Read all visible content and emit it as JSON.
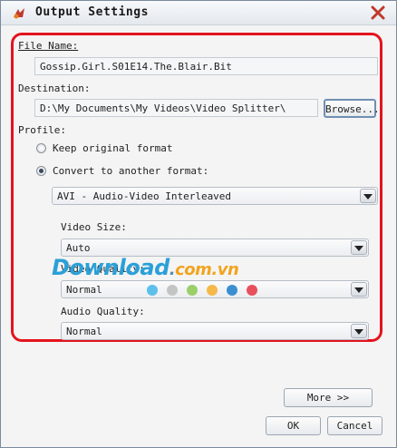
{
  "window": {
    "title": "Output Settings"
  },
  "file_name": {
    "label": "File Name:",
    "value": "Gossip.Girl.S01E14.The.Blair.Bit"
  },
  "destination": {
    "label": "Destination:",
    "value": "D:\\My Documents\\My Videos\\Video Splitter\\",
    "browse_label": "Browse..."
  },
  "profile": {
    "label": "Profile:",
    "keep_original": {
      "label": "Keep original format",
      "selected": false
    },
    "convert": {
      "label": "Convert to another format:",
      "selected": true
    },
    "format": {
      "value": "AVI - Audio-Video Interleaved"
    }
  },
  "video_size": {
    "label": "Video Size:",
    "value": "Auto"
  },
  "video_quality": {
    "label": "Video Quality:",
    "value": "Normal"
  },
  "audio_quality": {
    "label": "Audio Quality:",
    "value": "Normal"
  },
  "buttons": {
    "more": "More >>",
    "ok": "OK",
    "cancel": "Cancel"
  },
  "watermark": {
    "main": "Download",
    "dot": ".",
    "sub": "com.vn"
  },
  "colors": {
    "highlight_outline": "#e3141e",
    "dots": [
      "#5bc0eb",
      "#c4c4c4",
      "#9bcf6a",
      "#f5b84a",
      "#3a8fd0",
      "#e8505b"
    ]
  }
}
